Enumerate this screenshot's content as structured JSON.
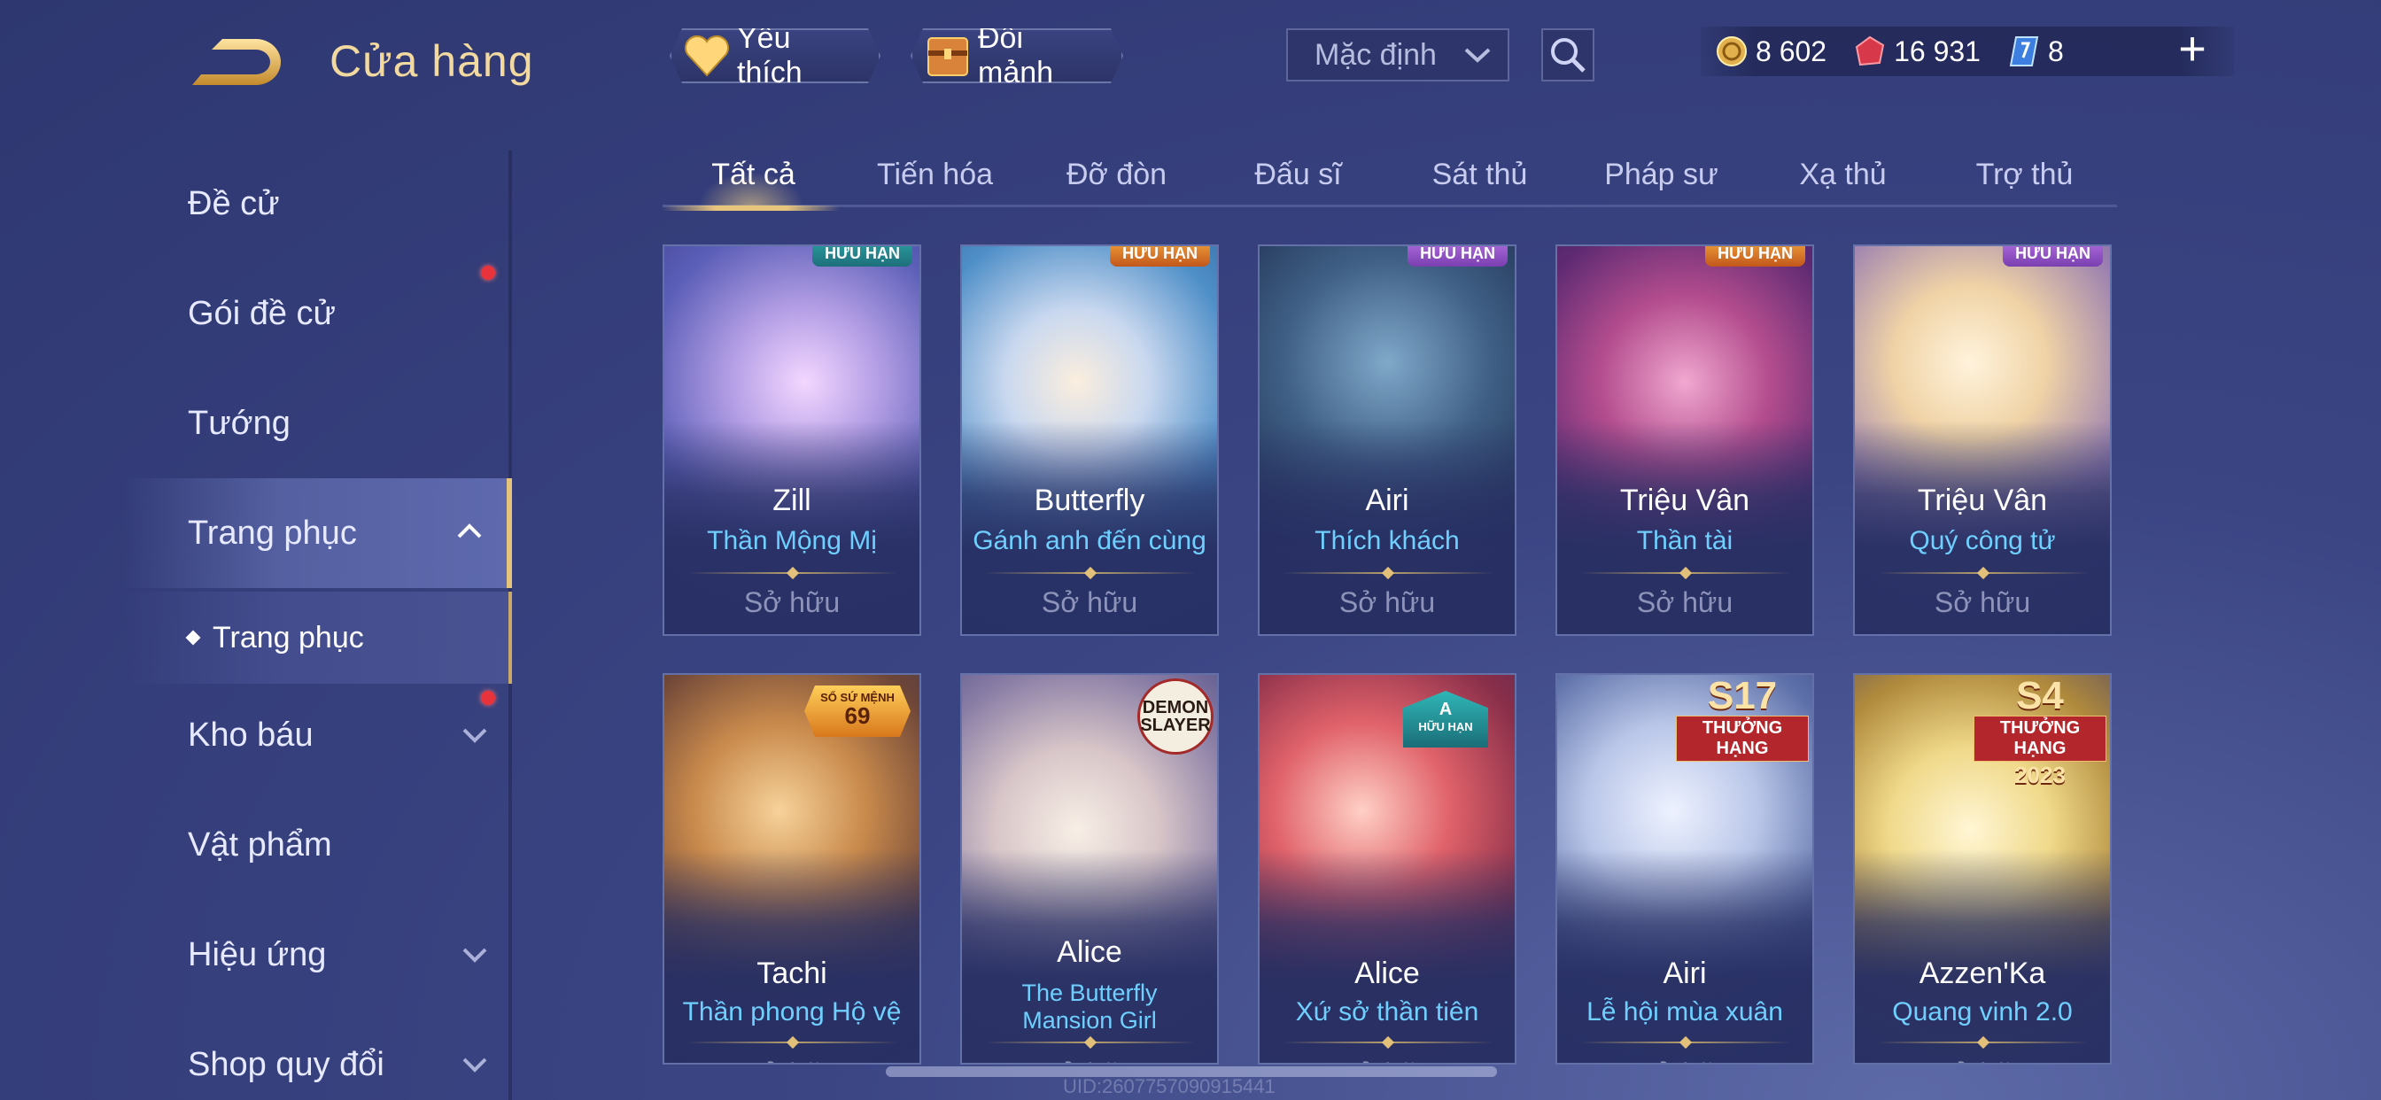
{
  "header": {
    "title": "Cửa hàng",
    "favorites_label": "Yêu thích",
    "exchange_label": "Đổi mảnh",
    "sort_value": "Mặc định",
    "currencies": [
      {
        "icon": "gold-coin-icon",
        "value": "8 602"
      },
      {
        "icon": "red-gem-icon",
        "value": "16 931"
      },
      {
        "icon": "blue-voucher-icon",
        "value": "8"
      }
    ],
    "plus_label": "+"
  },
  "sidebar": {
    "items": [
      {
        "label": "Đề cử"
      },
      {
        "label": "Gói đề cử"
      },
      {
        "label": "Tướng"
      },
      {
        "label": "Trang phục"
      },
      {
        "label": "Kho báu"
      },
      {
        "label": "Vật phẩm"
      },
      {
        "label": "Hiệu ứng"
      },
      {
        "label": "Shop quy đổi"
      }
    ],
    "sub_item": "Trang phục"
  },
  "tabs": [
    "Tất cả",
    "Tiến hóa",
    "Đỡ đòn",
    "Đấu sĩ",
    "Sát thủ",
    "Pháp sư",
    "Xạ thủ",
    "Trợ thủ"
  ],
  "cards": [
    {
      "hero": "Zill",
      "skin": "Thần Mộng Mị",
      "status": "Sở hữu",
      "badge": "HỮU HẠN"
    },
    {
      "hero": "Butterfly",
      "skin": "Gánh anh đến cùng",
      "status": "Sở hữu",
      "badge": "HỮU HẠN"
    },
    {
      "hero": "Airi",
      "skin": "Thích khách",
      "status": "Sở hữu",
      "badge": "HỮU HẠN"
    },
    {
      "hero": "Triệu Vân",
      "skin": "Thần tài",
      "status": "Sở hữu",
      "badge": "HỮU HẠN"
    },
    {
      "hero": "Triệu Vân",
      "skin": "Quý công tử",
      "status": "Sở hữu",
      "badge": "HỮU HẠN"
    },
    {
      "hero": "Tachi",
      "skin": "Thần phong Hộ vệ",
      "status": "Sở hữu",
      "badge_top": "SỐ SỨ MỆNH",
      "badge_num": "69"
    },
    {
      "hero": "Alice",
      "skin": "The Butterfly Mansion Girl",
      "status": "Sở hữu",
      "badge": "DEMON SLAYER"
    },
    {
      "hero": "Alice",
      "skin": "Xứ sở thần tiên",
      "status": "Sở hữu",
      "badge_top": "A",
      "badge_bottom": "HỮU HẠN"
    },
    {
      "hero": "Airi",
      "skin": "Lễ hội mùa xuân",
      "status": "Sở hữu",
      "badge_big": "S17",
      "badge_ribbon": "THƯỞNG HẠNG"
    },
    {
      "hero": "Azzen'Ka",
      "skin": "Quang vinh 2.0",
      "status": "Sở hữu",
      "badge_big": "S4",
      "badge_ribbon": "THƯỞNG HẠNG",
      "badge_year": "2023"
    }
  ],
  "footer": {
    "uid": "UID:2607757090915441"
  },
  "colors": {
    "accent_gold": "#e8c57d",
    "skin_blue": "#6fd0ff",
    "notification_red": "#e8323c"
  }
}
